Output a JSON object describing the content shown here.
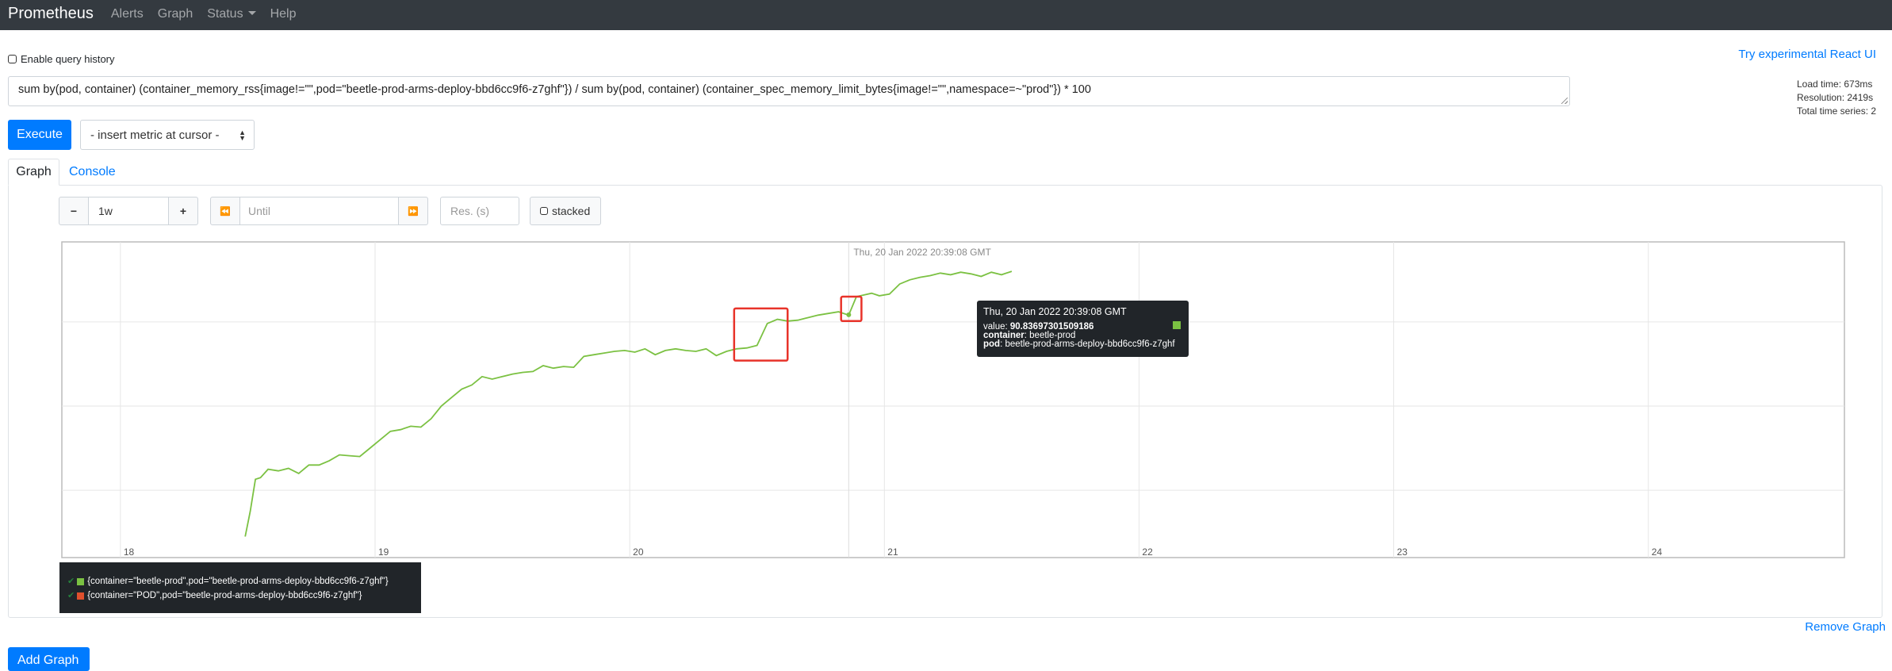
{
  "nav": {
    "brand": "Prometheus",
    "items": [
      "Alerts",
      "Graph",
      "Status",
      "Help"
    ]
  },
  "history_label": "Enable query history",
  "react_link": "Try experimental React UI",
  "stats": {
    "load_time": "Load time: 673ms",
    "resolution": "Resolution: 2419s",
    "total_series": "Total time series: 2"
  },
  "query": "sum by(pod, container) (container_memory_rss{image!=\"\",pod=\"beetle-prod-arms-deploy-bbd6cc9f6-z7ghf\"}) / sum by(pod, container) (container_spec_memory_limit_bytes{image!=\"\",namespace=~\"prod\"}) * 100",
  "execute_label": "Execute",
  "metric_select": "- insert metric at cursor -",
  "tabs": {
    "graph": "Graph",
    "console": "Console"
  },
  "controls": {
    "minus": "−",
    "range": "1w",
    "plus": "+",
    "back": "⏪",
    "until_placeholder": "Until",
    "forward": "⏩",
    "res_placeholder": "Res. (s)",
    "stacked": "stacked"
  },
  "colors": {
    "series_prod": "#7bc142",
    "series_pod": "#e0502d",
    "highlight": "#e8332a",
    "accent": "#007bff"
  },
  "chart_data": {
    "type": "line",
    "ylim": [
      62,
      99.5
    ],
    "xlim": [
      17.77,
      24.77
    ],
    "y_ticks": [
      70,
      80,
      90
    ],
    "x_ticks": [
      18,
      19,
      20,
      21,
      22,
      23,
      24
    ],
    "x_tick_labels": [
      "18",
      "19",
      "20",
      "21",
      "22",
      "23",
      "24"
    ],
    "hover_label": "Thu, 20 Jan 2022 20:39:08 GMT",
    "hover_x": 20.86,
    "series": [
      {
        "name": "{container=\"beetle-prod\",pod=\"beetle-prod-arms-deploy-bbd6cc9f6-z7ghf\"}",
        "x": [
          18.49,
          18.51,
          18.53,
          18.55,
          18.58,
          18.62,
          18.66,
          18.7,
          18.74,
          18.78,
          18.82,
          18.86,
          18.9,
          18.94,
          18.98,
          19.02,
          19.06,
          19.1,
          19.14,
          19.18,
          19.22,
          19.26,
          19.3,
          19.34,
          19.38,
          19.42,
          19.46,
          19.5,
          19.54,
          19.58,
          19.62,
          19.66,
          19.7,
          19.74,
          19.78,
          19.82,
          19.86,
          19.9,
          19.94,
          19.98,
          20.02,
          20.06,
          20.1,
          20.14,
          20.18,
          20.22,
          20.26,
          20.3,
          20.34,
          20.38,
          20.42,
          20.46,
          20.5,
          20.54,
          20.58,
          20.62,
          20.66,
          20.7,
          20.74,
          20.78,
          20.82,
          20.86,
          20.89,
          20.92,
          20.95,
          20.98,
          21.02,
          21.06,
          21.1,
          21.14,
          21.18,
          21.22,
          21.26,
          21.3,
          21.34,
          21.38,
          21.42,
          21.46,
          21.5
        ],
        "y": [
          64.5,
          67.5,
          71.3,
          71.5,
          72.5,
          72.3,
          72.6,
          72.0,
          73.0,
          73.0,
          73.5,
          74.2,
          74.1,
          74.0,
          75.0,
          76.0,
          77.0,
          77.2,
          77.6,
          77.5,
          78.5,
          80.0,
          81.0,
          82.0,
          82.5,
          83.5,
          83.2,
          83.5,
          83.8,
          84.0,
          84.1,
          84.8,
          84.5,
          84.7,
          84.6,
          85.9,
          86.1,
          86.3,
          86.5,
          86.6,
          86.4,
          86.8,
          86.1,
          86.6,
          86.8,
          86.6,
          86.5,
          86.8,
          86.0,
          86.5,
          86.8,
          86.9,
          87.2,
          89.8,
          90.3,
          90.1,
          90.2,
          90.5,
          90.8,
          91.0,
          91.2,
          90.8,
          93.0,
          93.2,
          93.4,
          93.1,
          93.3,
          94.5,
          95.0,
          95.3,
          95.5,
          95.8,
          95.6,
          95.9,
          95.7,
          95.4,
          95.9,
          95.6,
          96.0
        ]
      },
      {
        "name": "{container=\"POD\",pod=\"beetle-prod-arms-deploy-bbd6cc9f6-z7ghf\"}",
        "x": [],
        "y": []
      }
    ]
  },
  "tooltip": {
    "date": "Thu, 20 Jan 2022 20:39:08 GMT",
    "value_label": "value: ",
    "value": "90.83697301509186",
    "container_label": "container",
    "container": ": beetle-prod",
    "pod_label": "pod",
    "pod": ": beetle-prod-arms-deploy-bbd6cc9f6-z7ghf"
  },
  "remove_graph": "Remove Graph",
  "add_graph": "Add Graph"
}
